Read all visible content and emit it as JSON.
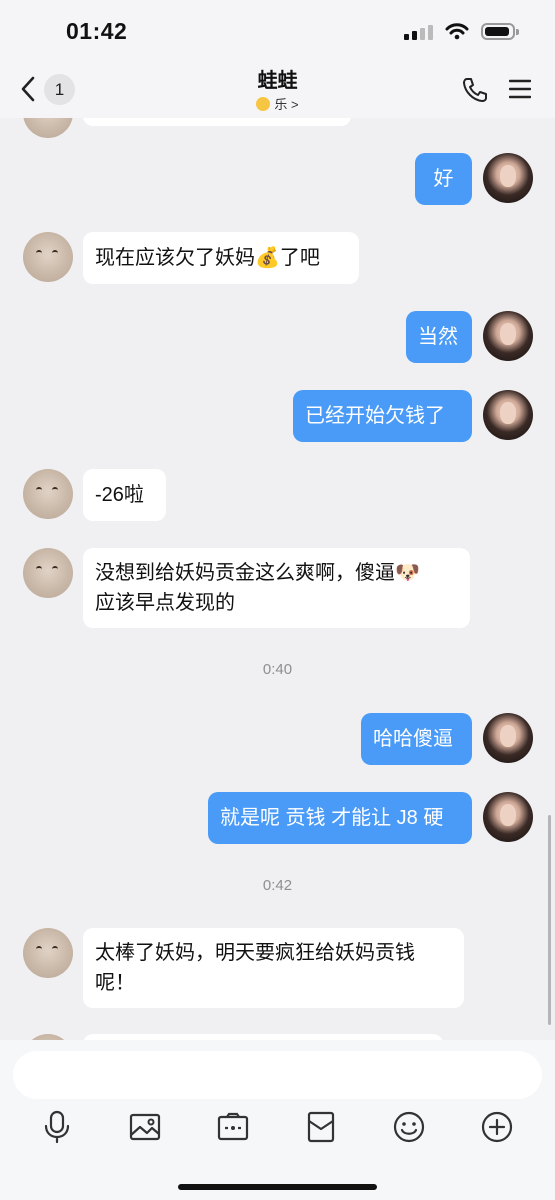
{
  "status_bar": {
    "time": "01:42"
  },
  "header": {
    "back_count": "1",
    "title": "蛙蛙",
    "subtitle": "乐 >"
  },
  "messages": [
    {
      "side": "out",
      "text": "好"
    },
    {
      "side": "in",
      "text": "现在应该欠了妖妈💰了吧"
    },
    {
      "side": "out",
      "text": "当然"
    },
    {
      "side": "out",
      "text": "已经开始欠钱了"
    },
    {
      "side": "in",
      "text": "-26啦"
    },
    {
      "side": "in",
      "text": "没想到给妖妈贡金这么爽啊，傻逼🐶\n应该早点发现的"
    },
    {
      "side": "out",
      "text": "哈哈傻逼"
    },
    {
      "side": "out",
      "text": "就是呢 贡钱 才能让 J8 硬"
    },
    {
      "side": "in",
      "text": "太棒了妖妈，明天要疯狂给妖妈贡钱\n呢！"
    }
  ],
  "timestamps": [
    "0:40",
    "0:42"
  ],
  "input": {
    "placeholder": ""
  },
  "toolbar": [
    "microphone-icon",
    "image-icon",
    "camera-icon",
    "red-packet-icon",
    "emoji-icon",
    "add-icon"
  ]
}
